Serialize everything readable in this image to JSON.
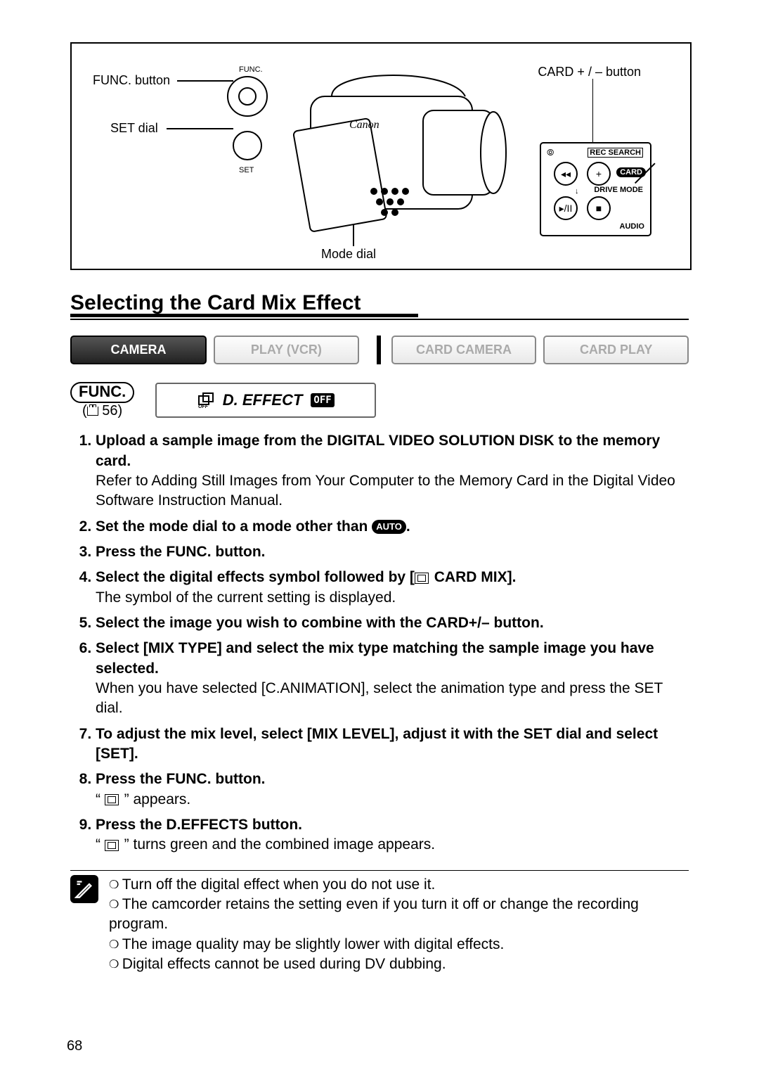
{
  "diagram": {
    "labels": {
      "func_button": "FUNC. button",
      "set_dial": "SET dial",
      "card_button": "CARD + / – button",
      "mode_dial": "Mode dial"
    },
    "panel": {
      "rec_search": "REC SEARCH",
      "card": "CARD",
      "drive_mode": "DRIVE MODE",
      "audio": "AUDIO"
    },
    "logo": "Canon"
  },
  "heading": "Selecting the Card Mix Effect",
  "mode_tabs": {
    "active": "CAMERA",
    "inactive": [
      "PLAY (VCR)",
      "CARD CAMERA",
      "CARD PLAY"
    ]
  },
  "func_ref": {
    "label": "FUNC.",
    "page": "56"
  },
  "effect_box": {
    "label": "D. EFFECT",
    "off": "OFF"
  },
  "steps": [
    {
      "head": "Upload a sample image from the DIGITAL VIDEO SOLUTION DISK to the memory card.",
      "body": "Refer to Adding Still Images from Your Computer to the Memory Card in the Digital Video Software Instruction Manual."
    },
    {
      "head_pre": "Set the mode dial to a mode other than ",
      "auto": "AUTO",
      "head_post": "."
    },
    {
      "head": "Press the FUNC. button."
    },
    {
      "head_pre": "Select the digital effects symbol followed by [",
      "mix_label": " CARD MIX].",
      "body": "The symbol of the current setting is displayed."
    },
    {
      "head": "Select the image you wish to combine with the CARD+/– button."
    },
    {
      "head": "Select [MIX TYPE] and select the mix type matching the sample image you have selected.",
      "body": "When you have selected [C.ANIMATION], select the animation type and press the SET dial."
    },
    {
      "head": "To adjust the mix level, select [MIX LEVEL], adjust it with the SET dial and select [SET]."
    },
    {
      "head": "Press the FUNC. button.",
      "body_pre": "“ ",
      "body_post": " ” appears."
    },
    {
      "head": "Press the D.EFFECTS button.",
      "body_pre": "“ ",
      "body_post": " ” turns green and the combined image appears."
    }
  ],
  "notes": [
    "Turn off the digital effect when you do not use it.",
    "The camcorder retains the setting even if you turn it off or change the recording program.",
    "The image quality may be slightly lower with digital effects.",
    "Digital effects cannot be used during DV dubbing."
  ],
  "page_number": "68"
}
